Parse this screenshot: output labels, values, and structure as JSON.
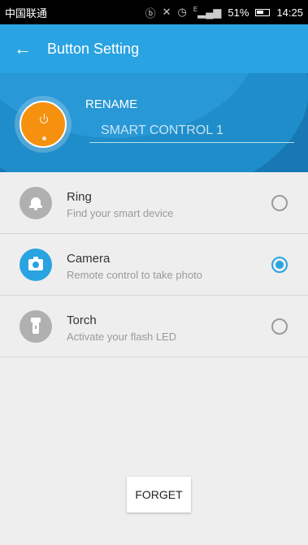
{
  "status_bar": {
    "carrier": "中国联通",
    "network": "E",
    "battery": "51%",
    "time": "14:25"
  },
  "app_bar": {
    "title": "Button Setting"
  },
  "banner": {
    "rename_label": "RENAME",
    "device_name": "SMART CONTROL 1"
  },
  "options": [
    {
      "title": "Ring",
      "subtitle": "Find your smart device",
      "icon": "bell-icon",
      "selected": false
    },
    {
      "title": "Camera",
      "subtitle": "Remote control to take photo",
      "icon": "camera-icon",
      "selected": true
    },
    {
      "title": "Torch",
      "subtitle": "Activate your flash LED",
      "icon": "flashlight-icon",
      "selected": false
    }
  ],
  "forget_button": "FORGET",
  "colors": {
    "primary": "#29a3e1",
    "banner": "#1878b3",
    "device": "#f5910f"
  }
}
